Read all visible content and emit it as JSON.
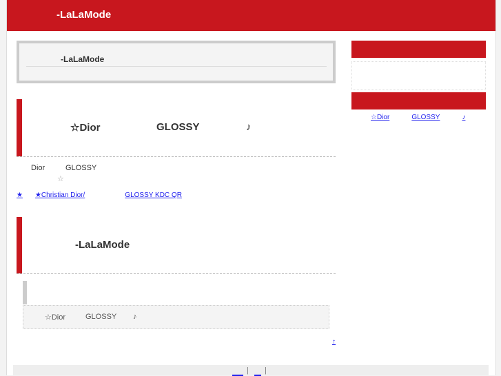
{
  "header": {
    "site_title": "-LaLaMode"
  },
  "intro": {
    "title": "-LaLaMode"
  },
  "post": {
    "title_parts": [
      "☆Dior",
      "GLOSSY",
      "♪"
    ],
    "body_line1": [
      "Dior",
      "GLOSSY"
    ],
    "body_line2": "☆",
    "link_parts": [
      "★",
      "★Christian Dior/",
      "GLOSSY KDC QR"
    ]
  },
  "section2": {
    "title": "-LaLaMode"
  },
  "related": {
    "parts": [
      "☆Dior",
      "GLOSSY",
      "♪"
    ]
  },
  "pagetop": {
    "label": "↑"
  },
  "sidebar": {
    "link_parts": [
      "☆Dior",
      "GLOSSY",
      "♪"
    ]
  },
  "footer": {
    "separator": "|"
  },
  "colors": {
    "brand": "#c8171e",
    "link": "#2222ee"
  }
}
